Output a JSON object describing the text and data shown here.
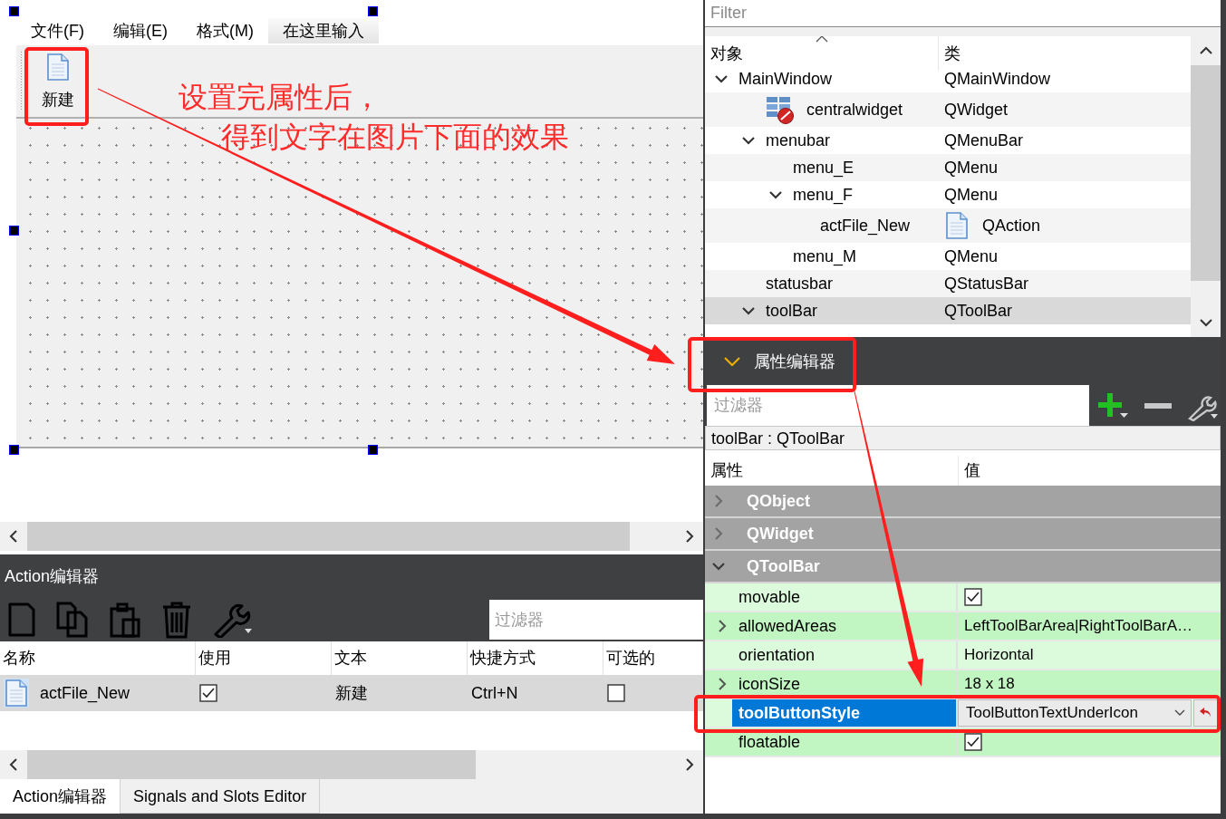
{
  "form": {
    "menu_bar": [
      {
        "label": "文件(F)",
        "kind": "menu"
      },
      {
        "label": "编辑(E)",
        "kind": "menu"
      },
      {
        "label": "格式(M)",
        "kind": "menu"
      },
      {
        "label": "在这里输入",
        "kind": "placeholder"
      }
    ],
    "toolbar": [
      {
        "label": "新建"
      }
    ]
  },
  "action_editor": {
    "title": "Action编辑器",
    "filter": {
      "placeholder": "过滤器"
    },
    "columns": [
      "名称",
      "使用",
      "文本",
      "快捷方式",
      "可选的"
    ],
    "rows": [
      {
        "name": "actFile_New",
        "used": true,
        "text": "新建",
        "shortcut": "Ctrl+N",
        "checkable": false,
        "selected": true
      }
    ],
    "tabs": [
      {
        "label": "Action编辑器",
        "selected": true
      },
      {
        "label": "Signals and Slots Editor",
        "selected": false
      }
    ]
  },
  "object_inspector": {
    "filter": {
      "placeholder": "Filter"
    },
    "columns": [
      "对象",
      "类"
    ],
    "tree": [
      {
        "name": "MainWindow",
        "class": "QMainWindow",
        "expanded": true,
        "selected": false,
        "children": [
          {
            "name": "centralwidget",
            "class": "QWidget",
            "kind": "widget",
            "selected": false
          },
          {
            "name": "menubar",
            "class": "QMenuBar",
            "expanded": true,
            "selected": false,
            "children": [
              {
                "name": "menu_E",
                "class": "QMenu",
                "selected": false
              },
              {
                "name": "menu_F",
                "class": "QMenu",
                "expanded": true,
                "selected": false,
                "children": [
                  {
                    "name": "actFile_New",
                    "class": "QAction",
                    "kind": "action",
                    "selected": false
                  }
                ]
              },
              {
                "name": "menu_M",
                "class": "QMenu",
                "selected": false
              }
            ]
          },
          {
            "name": "statusbar",
            "class": "QStatusBar",
            "selected": false
          },
          {
            "name": "toolBar",
            "class": "QToolBar",
            "expanded": true,
            "selected": true
          }
        ]
      }
    ]
  },
  "property_editor": {
    "title": "属性编辑器",
    "filter": {
      "placeholder": "过滤器"
    },
    "object": "toolBar : QToolBar",
    "columns": [
      "属性",
      "值"
    ],
    "groups": [
      {
        "name": "QObject",
        "expanded": false
      },
      {
        "name": "QWidget",
        "expanded": false
      },
      {
        "name": "QToolBar",
        "expanded": true,
        "properties": [
          {
            "name": "movable",
            "kind": "checkbox",
            "checked": true,
            "expandable": false,
            "selected": false
          },
          {
            "name": "allowedAreas",
            "kind": "text",
            "value": "LeftToolBarArea|RightToolBarA…",
            "expandable": true,
            "selected": false
          },
          {
            "name": "orientation",
            "kind": "text",
            "value": "Horizontal",
            "expandable": false,
            "selected": false
          },
          {
            "name": "iconSize",
            "kind": "text",
            "value": "18 x 18",
            "expandable": true,
            "selected": false
          },
          {
            "name": "toolButtonStyle",
            "kind": "combo",
            "value": "ToolButtonTextUnderIcon",
            "expandable": false,
            "selected": true
          },
          {
            "name": "floatable",
            "kind": "checkbox",
            "checked": true,
            "expandable": false,
            "selected": false
          }
        ]
      }
    ]
  },
  "annotation": {
    "lines": [
      "设置完属性后，",
      "得到文字在图片下面的效果"
    ]
  }
}
